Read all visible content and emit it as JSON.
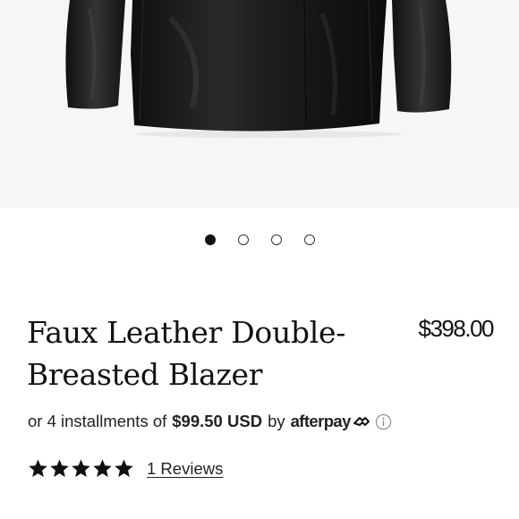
{
  "product": {
    "image_alt": "Black faux leather blazer",
    "title": "Faux Leather Double-Breasted Blazer",
    "price": "$398.00",
    "carousel": {
      "count": 4,
      "active_index": 0
    }
  },
  "payment": {
    "prefix": "or 4 installments of",
    "amount": "$99.50 USD",
    "by": "by",
    "provider": "afterpay"
  },
  "rating": {
    "stars": 5,
    "max": 5,
    "reviews_label": "1 Reviews"
  },
  "colors": {
    "background": "#ffffff",
    "image_background": "#f6f6f6",
    "text": "#111111",
    "jacket": "#1c1c1c"
  }
}
